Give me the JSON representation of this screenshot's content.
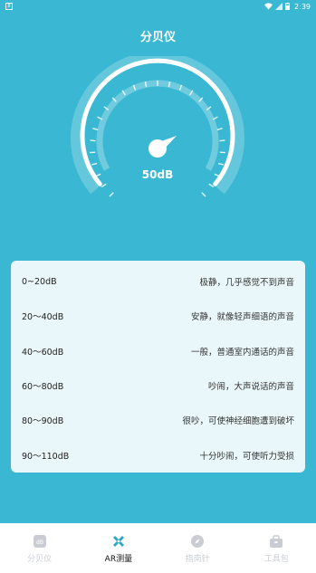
{
  "status_bar": {
    "time": "2:39",
    "app_icon_label": "8"
  },
  "header": {
    "title": "分贝仪"
  },
  "gauge": {
    "value_text": "50dB",
    "level": 0.5
  },
  "levels": [
    {
      "range": "0~20dB",
      "desc": "极静，几乎感觉不到声音"
    },
    {
      "range": "20～40dB",
      "desc": "安静，就像轻声细语的声音"
    },
    {
      "range": "40～60dB",
      "desc": "一般，普通室内通话的声音"
    },
    {
      "range": "60～80dB",
      "desc": "吵闹，大声说话的声音"
    },
    {
      "range": "80～90dB",
      "desc": "很吵，可使神经细胞遭到破坏"
    },
    {
      "range": "90～110dB",
      "desc": "十分吵闹，可使听力受损"
    }
  ],
  "tabs": [
    {
      "label": "分贝仪",
      "icon": "db-icon",
      "active": false
    },
    {
      "label": "AR测量",
      "icon": "ruler-pencil-icon",
      "active": true
    },
    {
      "label": "指南针",
      "icon": "compass-icon",
      "active": false
    },
    {
      "label": "工具包",
      "icon": "toolbox-icon",
      "active": false
    }
  ],
  "colors": {
    "background": "#3ab8d3",
    "card": "#eaf7fa",
    "tab_active": "#111111",
    "tab_inactive": "#c9cdd3"
  }
}
